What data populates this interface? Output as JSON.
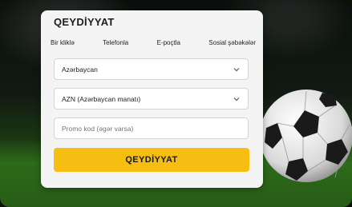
{
  "form": {
    "title": "QEYDİYYAT",
    "tabs": [
      {
        "label": "Bir kliklə"
      },
      {
        "label": "Telefonla"
      },
      {
        "label": "E-poçtla"
      },
      {
        "label": "Sosial şəbəkələr"
      }
    ],
    "country_select": {
      "value": "Azərbaycan",
      "icon": "chevron-down-icon"
    },
    "currency_select": {
      "value": "AZN (Azərbaycan manatı)",
      "icon": "chevron-down-icon"
    },
    "promo": {
      "placeholder": "Promo kod (əgər varsa)"
    },
    "submit_label": "QEYDİYYAT"
  },
  "colors": {
    "accent": "#f6bd13",
    "card_bg": "#f4f4f4",
    "field_border": "#d4d4d4"
  }
}
